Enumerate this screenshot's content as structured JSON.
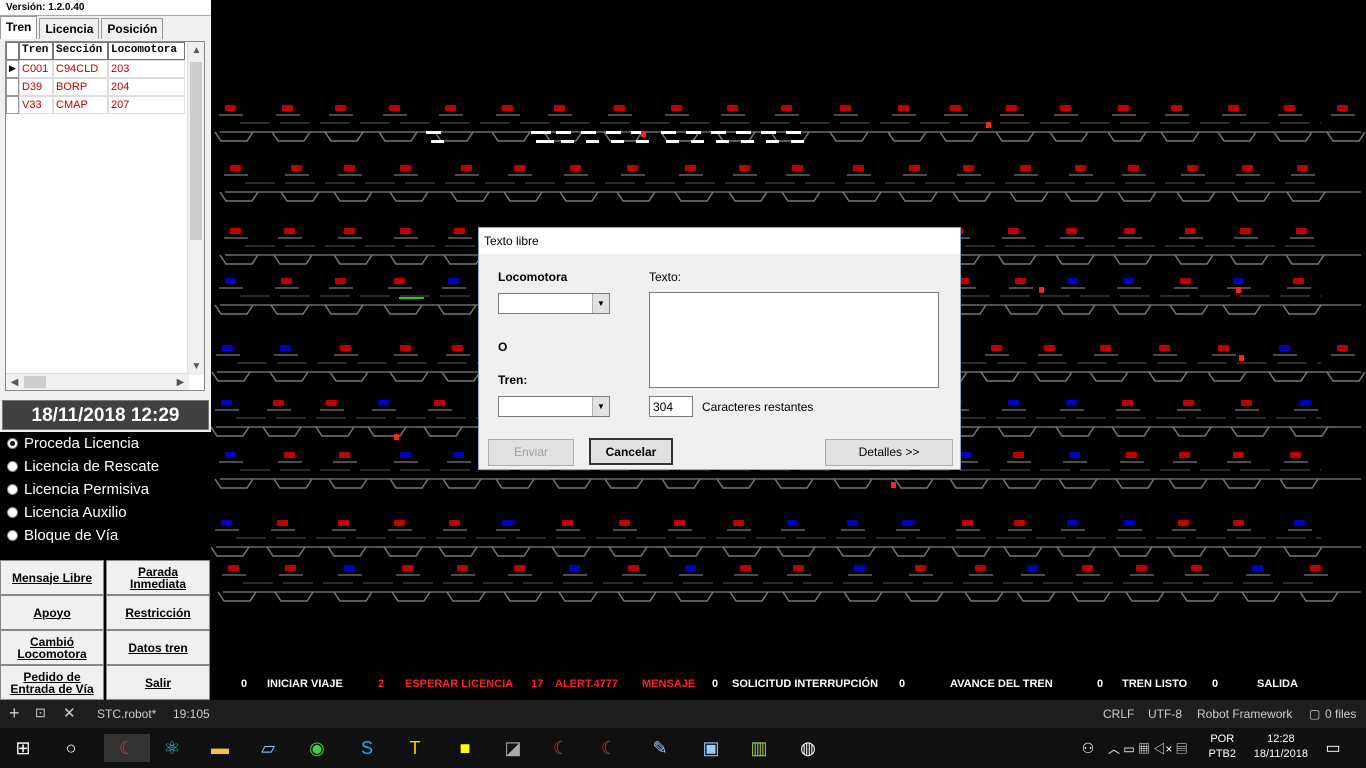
{
  "left_panel": {
    "version": "Versión: 1.2.0.40",
    "tabs": [
      "Tren",
      "Licencia",
      "Posición"
    ],
    "grid": {
      "columns": [
        "Tren",
        "Sección",
        "Locomotora"
      ],
      "rows": [
        {
          "tren": "C001",
          "seccion": "C94CLD",
          "locomotora": "203"
        },
        {
          "tren": "D39",
          "seccion": "BORP",
          "locomotora": "204"
        },
        {
          "tren": "V33",
          "seccion": "CMAP",
          "locomotora": "207"
        }
      ]
    },
    "datetime": "18/11/2018 12:29",
    "radio_options": [
      {
        "label": "Proceda Licencia",
        "selected": true
      },
      {
        "label": "Licencia de Rescate",
        "selected": false
      },
      {
        "label": "Licencia Permisiva",
        "selected": false
      },
      {
        "label": "Licencia Auxilio",
        "selected": false
      },
      {
        "label": "Bloque de Vía",
        "selected": false
      }
    ],
    "buttons": {
      "mensaje_libre": "Mensaje Libre",
      "parada_1": "Parada",
      "parada_2": "Inmediata",
      "apoyo": "Apoyo",
      "restriccion": "Restricción",
      "cambio_1": "Cambió",
      "cambio_2": "Locomotora",
      "datos_tren": "Datos tren",
      "pedido_1": "Pedido de",
      "pedido_2": "Entrada de Vía",
      "salir": "Salir"
    }
  },
  "status_bar": {
    "iniciar_viaje_count": "0",
    "iniciar_viaje": "INICIAR VIAJE",
    "esperar_licencia_count": "2",
    "esperar_licencia": "ESPERAR LICENCIA",
    "alert_count": "17",
    "alert": "ALERT.4777",
    "mensaje": "MENSAJE",
    "solicitud_count": "0",
    "solicitud": "SOLICITUD INTERRUPCIÓN",
    "avance_count": "0",
    "avance": "AVANCE DEL TREN",
    "tren_listo_count": "0",
    "tren_listo": "TREN LISTO",
    "salida_count": "0",
    "salida": "SALIDA"
  },
  "dialog": {
    "title": "Texto libre",
    "locomotora_label": "Locomotora",
    "or_label": "O",
    "tren_label": "Tren:",
    "texto_label": "Texto:",
    "chars_remaining_value": "304",
    "chars_remaining_label": "Caracteres restantes",
    "enviar": "Enviar",
    "cancelar": "Cancelar",
    "detalles": "Detalles >>"
  },
  "editor_bar": {
    "file": "STC.robot*",
    "position": "19:105",
    "eol": "CRLF",
    "encoding": "UTF-8",
    "language": "Robot Framework",
    "files": "0 files"
  },
  "taskbar": {
    "lang": "POR",
    "layout": "PTB2",
    "time": "12:28",
    "date": "18/11/2018"
  },
  "colors": {
    "alarm_red": "#ff2020",
    "station_red": "#c00000",
    "station_blue": "#0000c0"
  }
}
